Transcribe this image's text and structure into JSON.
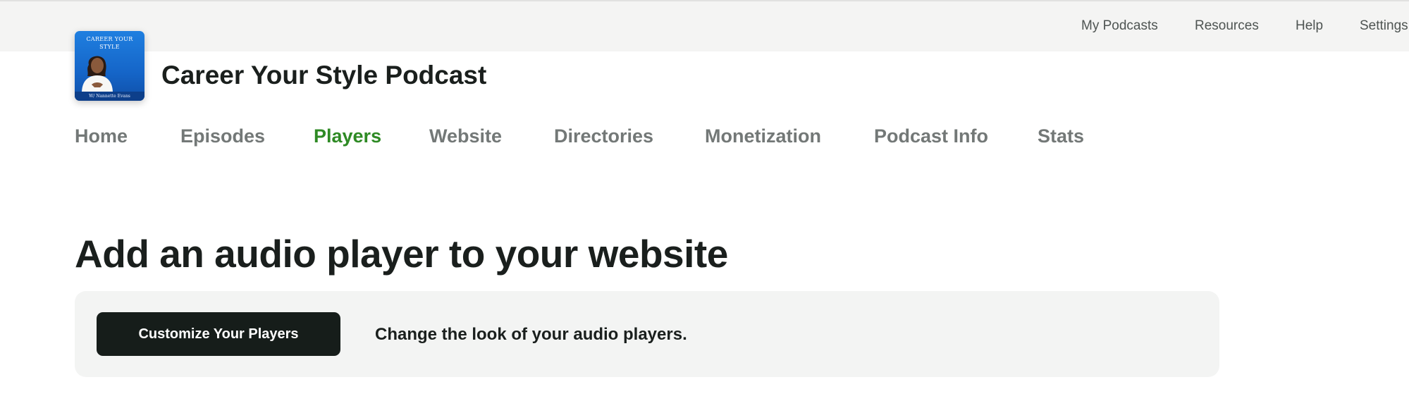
{
  "top_nav": {
    "items": [
      {
        "label": "My Podcasts"
      },
      {
        "label": "Resources"
      },
      {
        "label": "Help"
      },
      {
        "label": "Settings"
      }
    ]
  },
  "podcast": {
    "title": "Career Your Style Podcast",
    "artwork": {
      "title_line1": "CAREER YOUR",
      "title_line2": "STYLE",
      "footer": "W/ Nannette Evans",
      "colors": {
        "background": "#1565c8",
        "footer": "#0d3f8a"
      }
    }
  },
  "main_nav": {
    "items": [
      {
        "label": "Home"
      },
      {
        "label": "Episodes"
      },
      {
        "label": "Players",
        "active": true
      },
      {
        "label": "Website"
      },
      {
        "label": "Directories"
      },
      {
        "label": "Monetization"
      },
      {
        "label": "Podcast Info"
      },
      {
        "label": "Stats"
      }
    ],
    "active_color": "#2e8a24",
    "inactive_color": "#737877"
  },
  "main": {
    "heading": "Add an audio player to your website",
    "card": {
      "button_label": "Customize Your Players",
      "description": "Change the look of your audio players."
    }
  }
}
